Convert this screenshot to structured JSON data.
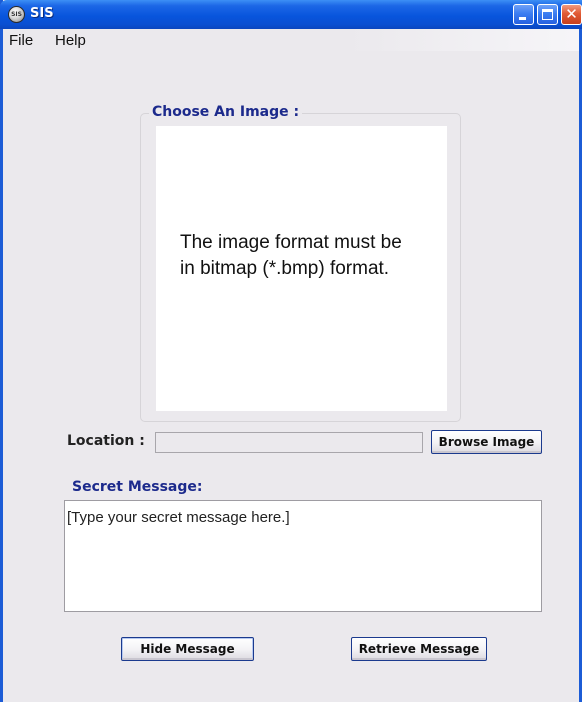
{
  "window": {
    "title": "SIS",
    "icon_text": "SIS",
    "controls": {
      "minimize": "minimize-icon",
      "maximize": "maximize-icon",
      "close": "close-icon",
      "close_glyph": "✕"
    }
  },
  "menu": {
    "items": [
      {
        "label": "File"
      },
      {
        "label": "Help"
      }
    ]
  },
  "image_section": {
    "title": "Choose An Image :",
    "note": "The image format must be\nin bitmap (*.bmp) format."
  },
  "location": {
    "label": "Location :",
    "value": "",
    "browse_label": "Browse Image"
  },
  "secret": {
    "label": "Secret Message:",
    "text": "[Type your secret message here.]"
  },
  "actions": {
    "hide_label": "Hide Message",
    "retrieve_label": "Retrieve Message"
  },
  "colors": {
    "titlebar": "#0855dd",
    "window_bg": "#ebe9ed",
    "label_blue": "#1c2a8c"
  }
}
